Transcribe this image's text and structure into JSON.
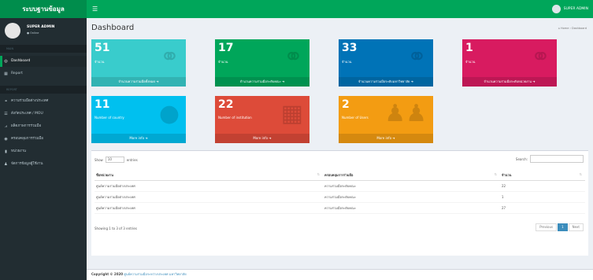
{
  "app": {
    "brand": "ระบบฐานข้อมูล",
    "toggle_icon": "bars-icon",
    "user_name": "SUPER ADMIN"
  },
  "sidebar": {
    "user": {
      "name": "SUPER ADMIN",
      "status": "● Online"
    },
    "header_top": "MAIN",
    "header_mid": "REPORT",
    "items": [
      {
        "label": "Dashboard",
        "icon": "dashboard-icon",
        "glyph": "◎",
        "active": true
      },
      {
        "label": "Report",
        "icon": "table-icon",
        "glyph": "▦",
        "active": false
      },
      {
        "label": "ความร่วมมือต่างประเทศ",
        "icon": "handshake-icon",
        "glyph": "⚭",
        "active": false
      },
      {
        "label": "สังกัดประเทศ / MOU",
        "icon": "list-icon",
        "glyph": "☰",
        "active": false
      },
      {
        "label": "ผลิตภาพการร่วมมือ",
        "icon": "chart-icon",
        "glyph": "⩘",
        "active": false
      },
      {
        "label": "ครอบคลุมการร่วมมือ",
        "icon": "globe-icon",
        "glyph": "◉",
        "active": false
      },
      {
        "label": "หน่วยงาน",
        "icon": "building-icon",
        "glyph": "▮",
        "active": false
      },
      {
        "label": "จัดการข้อมูลผู้ใช้งาน",
        "icon": "users-icon",
        "glyph": "♟",
        "active": false
      }
    ]
  },
  "page": {
    "title": "Dashboard",
    "breadcrumb": "⌂ Home › Dashboard"
  },
  "stats": [
    {
      "num": "51",
      "label": "จำนวน",
      "foot": "จำนวนความร่วมมือทั้งหมด ➜",
      "color": "#39cccc",
      "icon": "handshake-icon"
    },
    {
      "num": "17",
      "label": "จำนวน",
      "foot": "จำนวนความร่วมมือระดับคณะ ➜",
      "color": "#00a65a",
      "icon": "handshake-icon"
    },
    {
      "num": "33",
      "label": "จำนวน",
      "foot": "จำนวนความร่วมมือระดับมหาวิทยาลัย ➜",
      "color": "#0073b7",
      "icon": "handshake-icon"
    },
    {
      "num": "1",
      "label": "จำนวน",
      "foot": "จำนวนความร่วมมือระดับหน่วยงาน ➜",
      "color": "#d81b60",
      "icon": "handshake-icon"
    },
    {
      "num": "11",
      "label": "Number of country",
      "foot": "More info ➜",
      "color": "#00c0ef",
      "icon": "globe-icon"
    },
    {
      "num": "22",
      "label": "Number of institution",
      "foot": "More info ➜",
      "color": "#dd4b39",
      "icon": "building-icon"
    },
    {
      "num": "2",
      "label": "Number of Users",
      "foot": "More info ➜",
      "color": "#f39c12",
      "icon": "users-icon"
    }
  ],
  "table": {
    "show_label": "Show",
    "show_value": "10",
    "entries_label": "entries",
    "search_label": "Search:",
    "columns": [
      "ชื่อหน่วยงาน",
      "ครอบคลุมการร่วมมือ",
      "จำนวน"
    ],
    "rows": [
      [
        "ศูนย์ความร่วมมือต่างประเทศ",
        "ความร่วมมือระดับคณะ",
        "22"
      ],
      [
        "ศูนย์ความร่วมมือต่างประเทศ",
        "ความร่วมมือระดับคณะ",
        "1"
      ],
      [
        "ศูนย์ความร่วมมือต่างประเทศ",
        "ความร่วมมือระดับคณะ",
        "27"
      ]
    ],
    "info": "Showing 1 to 3 of 3 entries",
    "pager": {
      "prev": "Previous",
      "page": "1",
      "next": "Next"
    }
  },
  "footer": {
    "prefix": "Copyright © 2020",
    "link": "ศูนย์ความร่วมมือระหว่างประเทศ มหาวิทยาลัย"
  }
}
